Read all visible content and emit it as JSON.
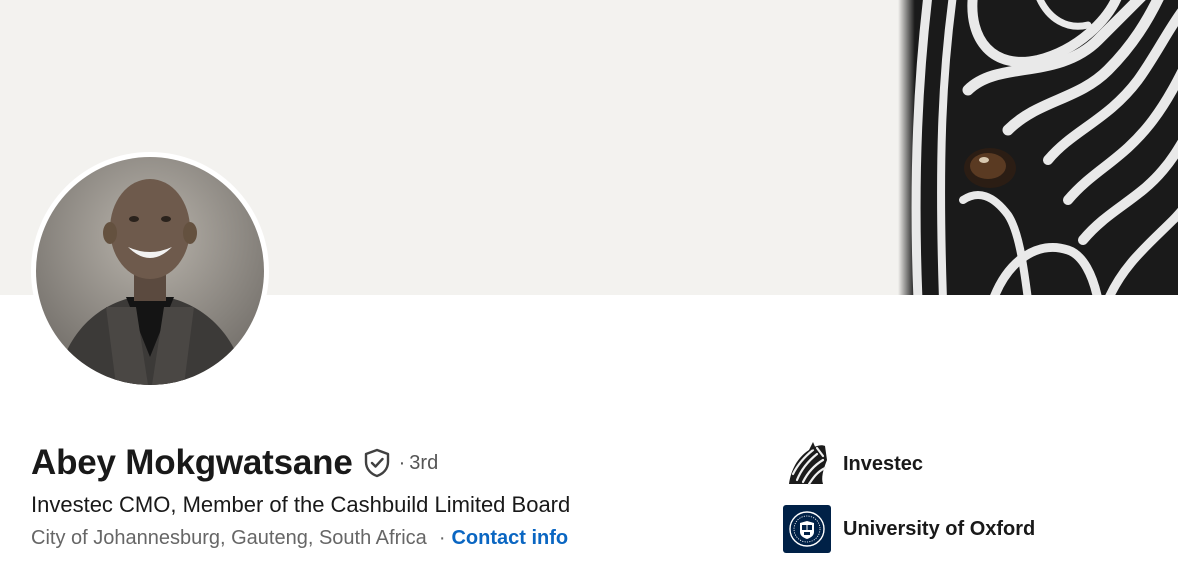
{
  "profile": {
    "name": "Abey Mokgwatsane",
    "connection_degree": "3rd",
    "degree_separator": "·",
    "headline": "Investec CMO, Member of the Cashbuild Limited Board",
    "location": "City of Johannesburg, Gauteng, South Africa",
    "location_separator": "·",
    "contact_info_label": "Contact info"
  },
  "organizations": [
    {
      "name": "Investec",
      "icon": "zebra-logo-icon"
    },
    {
      "name": "University of Oxford",
      "icon": "oxford-crest-icon"
    }
  ],
  "colors": {
    "banner_bg": "#f3f2ef",
    "link": "#0a66c2",
    "text_primary": "#191919",
    "text_secondary": "#666666",
    "oxford_blue": "#002147"
  }
}
